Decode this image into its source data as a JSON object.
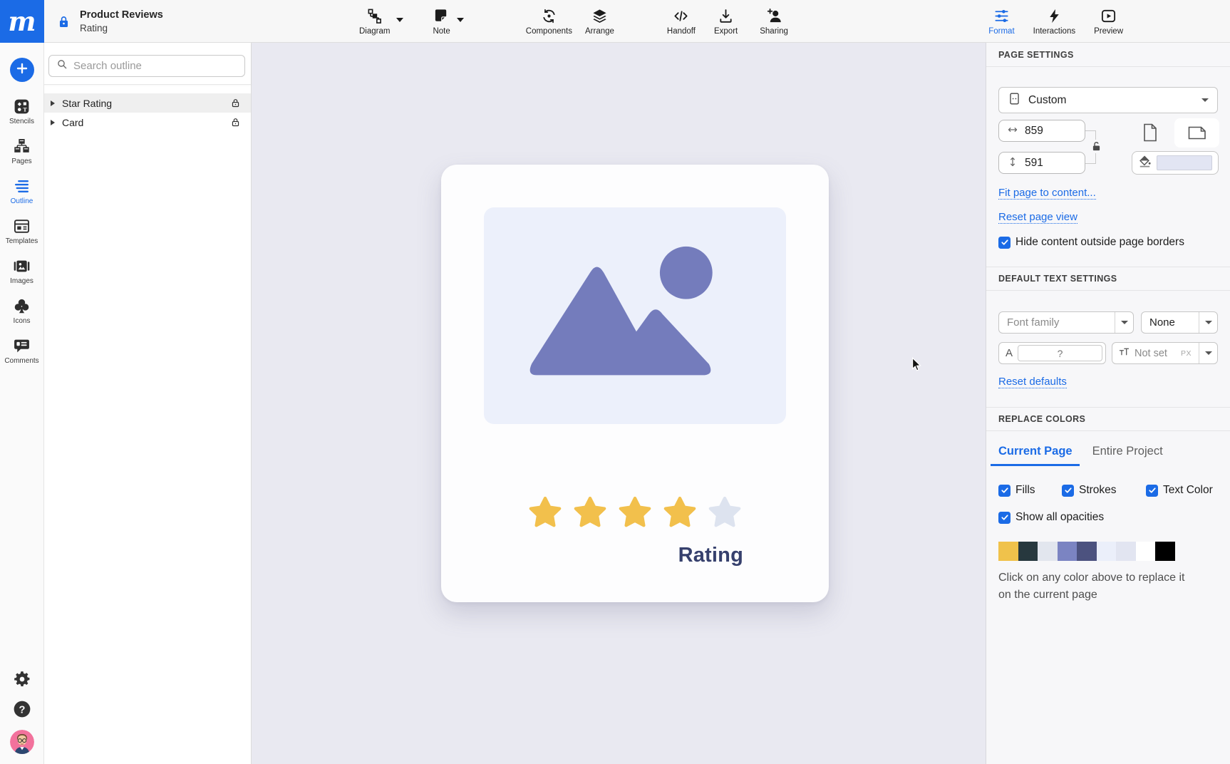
{
  "colors": {
    "accent": "#1B6BE6",
    "star-gold": "#F2C04C",
    "star-empty": "#DDE3EF",
    "illustration-purple": "#747CBC",
    "canvas-bg": "#E9E9F1",
    "card-bg": "#FDFDFE",
    "placeholder-bg": "#ECF0FB",
    "rating-text": "#36406D",
    "page-fill-swatch": "#E2E5F3"
  },
  "logo_letter": "m",
  "topbar": {
    "project_title": "Product Reviews",
    "page_name": "Rating",
    "tools": [
      {
        "label": "Diagram",
        "has_dropdown": true
      },
      {
        "label": "Note",
        "has_dropdown": true
      },
      {
        "label": "Components"
      },
      {
        "label": "Arrange"
      },
      {
        "label": "Handoff"
      },
      {
        "label": "Export"
      },
      {
        "label": "Sharing"
      }
    ],
    "right_tools": [
      {
        "label": "Format",
        "active": true
      },
      {
        "label": "Interactions",
        "active": false
      },
      {
        "label": "Preview",
        "active": false
      }
    ]
  },
  "rail": {
    "items": [
      {
        "label": "Stencils"
      },
      {
        "label": "Pages"
      },
      {
        "label": "Outline",
        "active": true
      },
      {
        "label": "Templates"
      },
      {
        "label": "Images"
      },
      {
        "label": "Icons"
      },
      {
        "label": "Comments"
      }
    ]
  },
  "outline_panel": {
    "search_placeholder": "Search outline",
    "rows": [
      {
        "label": "Star Rating",
        "locked": true,
        "selected": true
      },
      {
        "label": "Card",
        "locked": true,
        "selected": false
      }
    ]
  },
  "canvas": {
    "rating_label": "Rating",
    "stars_total": 5,
    "stars_filled": 4
  },
  "page_settings": {
    "title": "PAGE SETTINGS",
    "size_preset": "Custom",
    "width": "859",
    "height": "591",
    "dimensions_linked": false,
    "orientation": "landscape",
    "fit_link": "Fit page to content...",
    "reset_link": "Reset page view",
    "hide_content_label": "Hide content outside page borders",
    "hide_content_checked": true
  },
  "default_text_settings": {
    "title": "DEFAULT TEXT SETTINGS",
    "font_family_placeholder": "Font family",
    "style_value": "None",
    "font_size_prefix": "A",
    "size_placeholder": "?",
    "size_unit_value": "Not set",
    "size_unit_suffix": "PX",
    "reset_link": "Reset defaults"
  },
  "replace_colors": {
    "title": "REPLACE COLORS",
    "tabs": [
      {
        "label": "Current Page",
        "active": true
      },
      {
        "label": "Entire Project",
        "active": false
      }
    ],
    "checkboxes": [
      {
        "label": "Fills",
        "checked": true
      },
      {
        "label": "Strokes",
        "checked": true
      },
      {
        "label": "Text Color",
        "checked": true
      }
    ],
    "show_all_opacities": {
      "label": "Show all opacities",
      "checked": true
    },
    "swatches": [
      "#F0C24B",
      "#27383E",
      "#E2E6EE",
      "#7B84C2",
      "#4C527F",
      "#EBEFFA",
      "#E2E5F1",
      "#FFFFFF",
      "#000000"
    ],
    "caption_line1": "Click on any color above to replace it",
    "caption_line2": "on the current page"
  }
}
